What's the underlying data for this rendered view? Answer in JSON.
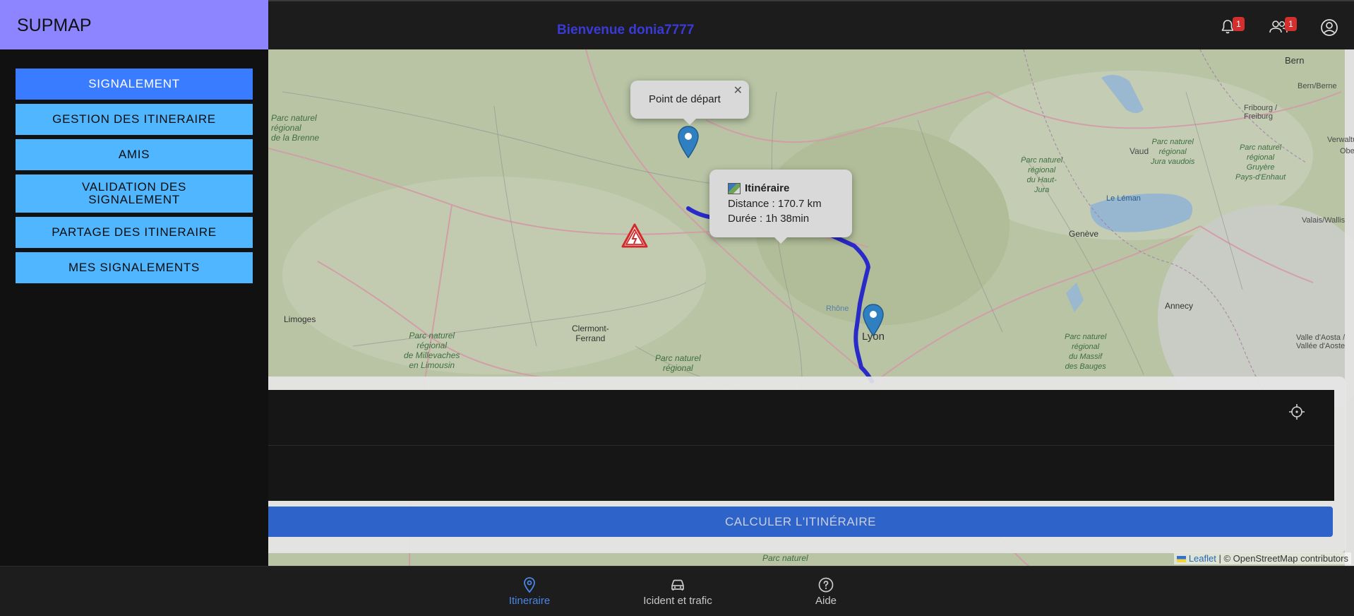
{
  "header": {
    "welcome": "Bienvenue donia7777",
    "notifications_count": "1",
    "friend_requests_count": "1"
  },
  "sidebar": {
    "brand": "SUPMAP",
    "items": [
      {
        "label": "SIGNALEMENT",
        "active": true
      },
      {
        "label": "GESTION DES ITINERAIRE"
      },
      {
        "label": "AMIS"
      },
      {
        "label": "VALIDATION DES SIGNALEMENT"
      },
      {
        "label": "PARTAGE DES ITINERAIRE"
      },
      {
        "label": "MES SIGNALEMENTS"
      }
    ]
  },
  "map": {
    "start_popup": "Point de départ",
    "route_popup": {
      "title": "Itinéraire",
      "distance": "Distance : 170.7 km",
      "duration": "Durée : 1h 38min"
    },
    "labels": {
      "bern": "Bern",
      "bern_alt": "Bern/Berne",
      "fribourg": "Fribourg /\nFreiburg",
      "vaud": "Vaud",
      "geneve": "Genève",
      "leman": "Le Léman",
      "annecy": "Annecy",
      "lyon": "Lyon",
      "rhone": "Rhône",
      "limoges": "Limoges",
      "clermont": "Clermont-\nFerrand",
      "valais": "Valais/Wallis",
      "aosta": "Valle d'Aosta /\nVallée d'Aoste",
      "park_brenne": "Parc naturel\nrégional\nde la Brenne",
      "park_millevaches": "Parc naturel\nrégional\nde Millevaches\nen Limousin",
      "park_livradois": "Parc naturel\nrégional",
      "park_haut_jura": "Parc naturel\nrégional\ndu Haut-\nJura",
      "park_jura_vaudois": "Parc naturel\nrégional\nJura vaudois",
      "park_gruyere": "Parc naturel\nrégional\nGruyère\nPays-d'Enhaut",
      "park_bauges": "Parc naturel\nrégional\ndu Massif\ndes Bauges",
      "park_bottom": "Parc naturel",
      "wald": "Verwaltu",
      "obe": "Obe"
    },
    "attribution": {
      "leaflet": "Leaflet",
      "osm": "| © OpenStreetMap contributors"
    }
  },
  "form": {
    "calculate_label": "CALCULER L'ITINÉRAIRE"
  },
  "bottom_nav": [
    {
      "label": "Itineraire",
      "icon": "location-pin-icon",
      "active": true
    },
    {
      "label": "Icident et trafic",
      "icon": "car-icon"
    },
    {
      "label": "Aide",
      "icon": "help-circle-icon"
    }
  ],
  "colors": {
    "brand_bg": "#8c85ff",
    "menu_active": "#3a7cff",
    "menu_item": "#4fb6ff",
    "route": "#2a2ac8",
    "calc_button": "#2e63c9",
    "badge": "#d32f2f"
  }
}
